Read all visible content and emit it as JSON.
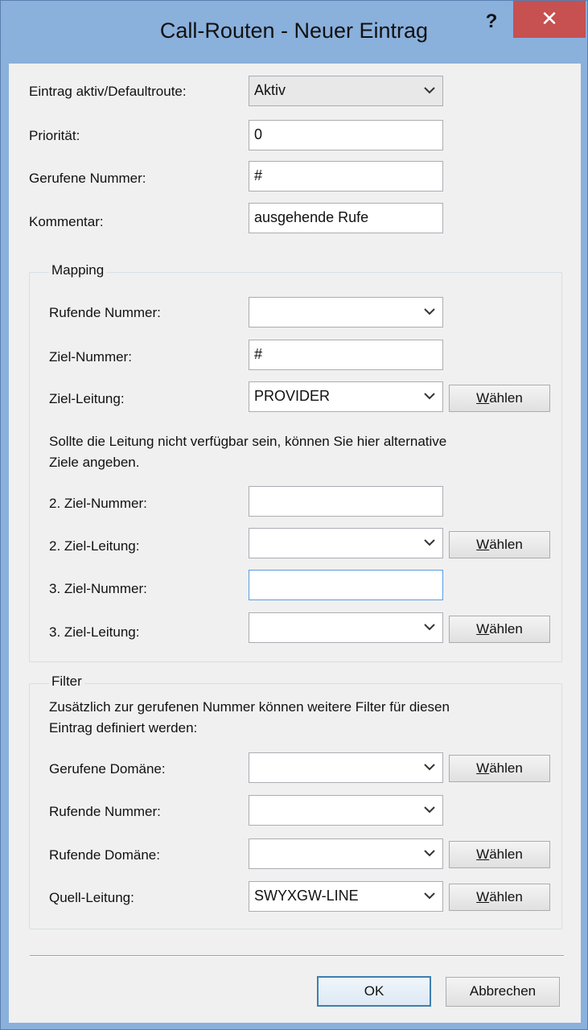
{
  "window": {
    "title": "Call-Routen - Neuer Eintrag",
    "help_label": "?",
    "close_label": "✕"
  },
  "general": {
    "active_label": "Eintrag aktiv/Defaultroute:",
    "active_value": "Aktiv",
    "priority_label": "Priorität:",
    "priority_value": "0",
    "called_number_label": "Gerufene Nummer:",
    "called_number_value": "#",
    "comment_label": "Kommentar:",
    "comment_value": "ausgehende Rufe"
  },
  "mapping": {
    "title": "Mapping",
    "calling_number_label": "Rufende Nummer:",
    "calling_number_value": "",
    "target_number_label": "Ziel-Nummer:",
    "target_number_value": "#",
    "target_line_label": "Ziel-Leitung:",
    "target_line_value": "PROVIDER",
    "info_line1": "Sollte die Leitung nicht verfügbar sein, können Sie hier alternative",
    "info_line2": "Ziele angeben.",
    "target2_number_label": "2. Ziel-Nummer:",
    "target2_number_value": "",
    "target2_line_label": "2. Ziel-Leitung:",
    "target2_line_value": "",
    "target3_number_label": "3. Ziel-Nummer:",
    "target3_number_value": "",
    "target3_line_label": "3. Ziel-Leitung:",
    "target3_line_value": ""
  },
  "filter": {
    "title": "Filter",
    "info_line1": "Zusätzlich zur gerufenen Nummer können weitere Filter für diesen",
    "info_line2": "Eintrag definiert werden:",
    "called_domain_label": "Gerufene Domäne:",
    "called_domain_value": "",
    "calling_number_label": "Rufende Nummer:",
    "calling_number_value": "",
    "calling_domain_label": "Rufende Domäne:",
    "calling_domain_value": "",
    "source_line_label": "Quell-Leitung:",
    "source_line_value": "SWYXGW-LINE"
  },
  "buttons": {
    "choose_accel": "W",
    "choose_rest": "ählen",
    "ok": "OK",
    "cancel": "Abbrechen"
  },
  "icons": {
    "dropdown": "chevron-down-icon"
  }
}
